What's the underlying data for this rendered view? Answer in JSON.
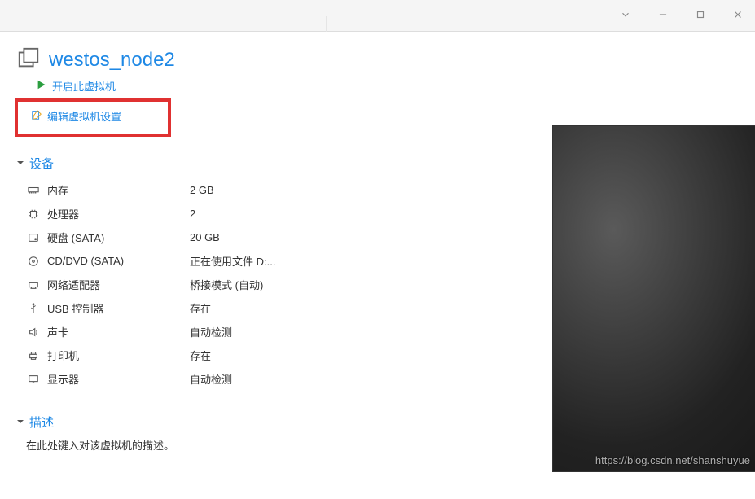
{
  "vm": {
    "title": "westos_node2"
  },
  "actions": {
    "start": "开启此虚拟机",
    "edit_settings": "编辑虚拟机设置"
  },
  "sections": {
    "devices": "设备",
    "description": "描述"
  },
  "devices": [
    {
      "label": "内存",
      "value": "2 GB"
    },
    {
      "label": "处理器",
      "value": "2"
    },
    {
      "label": "硬盘 (SATA)",
      "value": "20 GB"
    },
    {
      "label": "CD/DVD (SATA)",
      "value": "正在使用文件 D:..."
    },
    {
      "label": "网络适配器",
      "value": "桥接模式 (自动)"
    },
    {
      "label": "USB 控制器",
      "value": "存在"
    },
    {
      "label": "声卡",
      "value": "自动检测"
    },
    {
      "label": "打印机",
      "value": "存在"
    },
    {
      "label": "显示器",
      "value": "自动检测"
    }
  ],
  "description": {
    "placeholder": "在此处键入对该虚拟机的描述。"
  },
  "watermark": "https://blog.csdn.net/shanshuyue"
}
